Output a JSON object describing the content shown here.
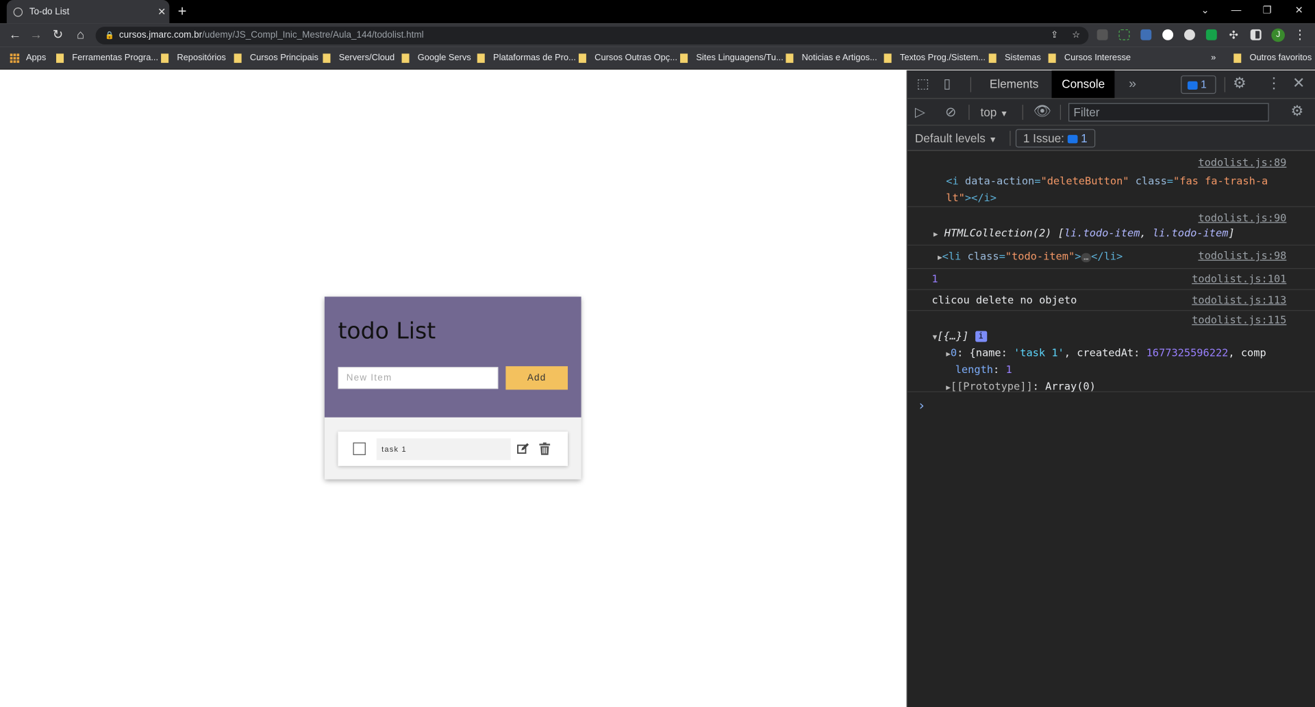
{
  "browser": {
    "tab_title": "To-do List",
    "tab_close": "✕",
    "new_tab": "+",
    "url_host": "cursos.jmarc.com.br",
    "url_path": "/udemy/JS_Compl_Inic_Mestre/Aula_144/todolist.html",
    "profile_initial": "J",
    "bookmarks": [
      "Apps",
      "Ferramentas Progra...",
      "Repositórios",
      "Cursos Principais",
      "Servers/Cloud",
      "Google Servs",
      "Plataformas de Pro...",
      "Cursos Outras Opç...",
      "Sites Linguagens/Tu...",
      "Noticias e Artigos...",
      "Textos Prog./Sistem...",
      "Sistemas",
      "Cursos Interesse"
    ],
    "bookmarks_more": "»",
    "other_bookmarks": "Outros favoritos",
    "colors": {
      "tabstrip": "#000000",
      "toolbar": "#35363a",
      "folder": "#f3d26b"
    }
  },
  "app": {
    "title": "todo List",
    "input_placeholder": "New Item",
    "add_label": "Add",
    "items": [
      {
        "name": "task 1",
        "done": false
      }
    ],
    "colors": {
      "header": "#726891",
      "add_button": "#f3c15e"
    }
  },
  "devtools": {
    "tabs": [
      "Elements",
      "Console"
    ],
    "active_tab": "Console",
    "more": "»",
    "issues_count": "1",
    "context": "top",
    "filter_placeholder": "Filter",
    "levels": "Default levels",
    "issue_label": "1 Issue:",
    "issue_count2": "1",
    "prompt": "›",
    "logs": [
      {
        "src": "todolist.js:89",
        "l1a": "<i ",
        "l1b": "data-action",
        "l1c": "=",
        "l1d": "\"deleteButton\"",
        "l1e": " class",
        "l1f": "=",
        "l1g": "\"fas fa-trash-a",
        "l2": "lt\"",
        "l2b": "></i>"
      },
      {
        "src": "todolist.js:90",
        "a": "HTMLCollection(2) [",
        "b": "li.todo-item",
        "c": ", ",
        "d": "li.todo-item",
        "e": "]"
      },
      {
        "src": "todolist.js:98",
        "a": "<li ",
        "b": "class",
        "c": "=",
        "d": "\"todo-item\"",
        "e": ">",
        "f": "…",
        "g": "</li>"
      },
      {
        "src": "todolist.js:101",
        "text": "1"
      },
      {
        "src": "todolist.js:113",
        "text": "clicou delete no objeto"
      },
      {
        "src": "todolist.js:115",
        "summary": "[{…}]",
        "info": "i",
        "row0_key": "0",
        "row0_a": ": {name: ",
        "row0_b": "'task 1'",
        "row0_c": ", createdAt: ",
        "row0_d": "1677325596222",
        "row0_e": ", comp",
        "len_key": "length",
        "len_sep": ": ",
        "len_val": "1",
        "proto_key": "[[Prototype]]",
        "proto_sep": ": ",
        "proto_val": "Array(0)"
      }
    ]
  }
}
